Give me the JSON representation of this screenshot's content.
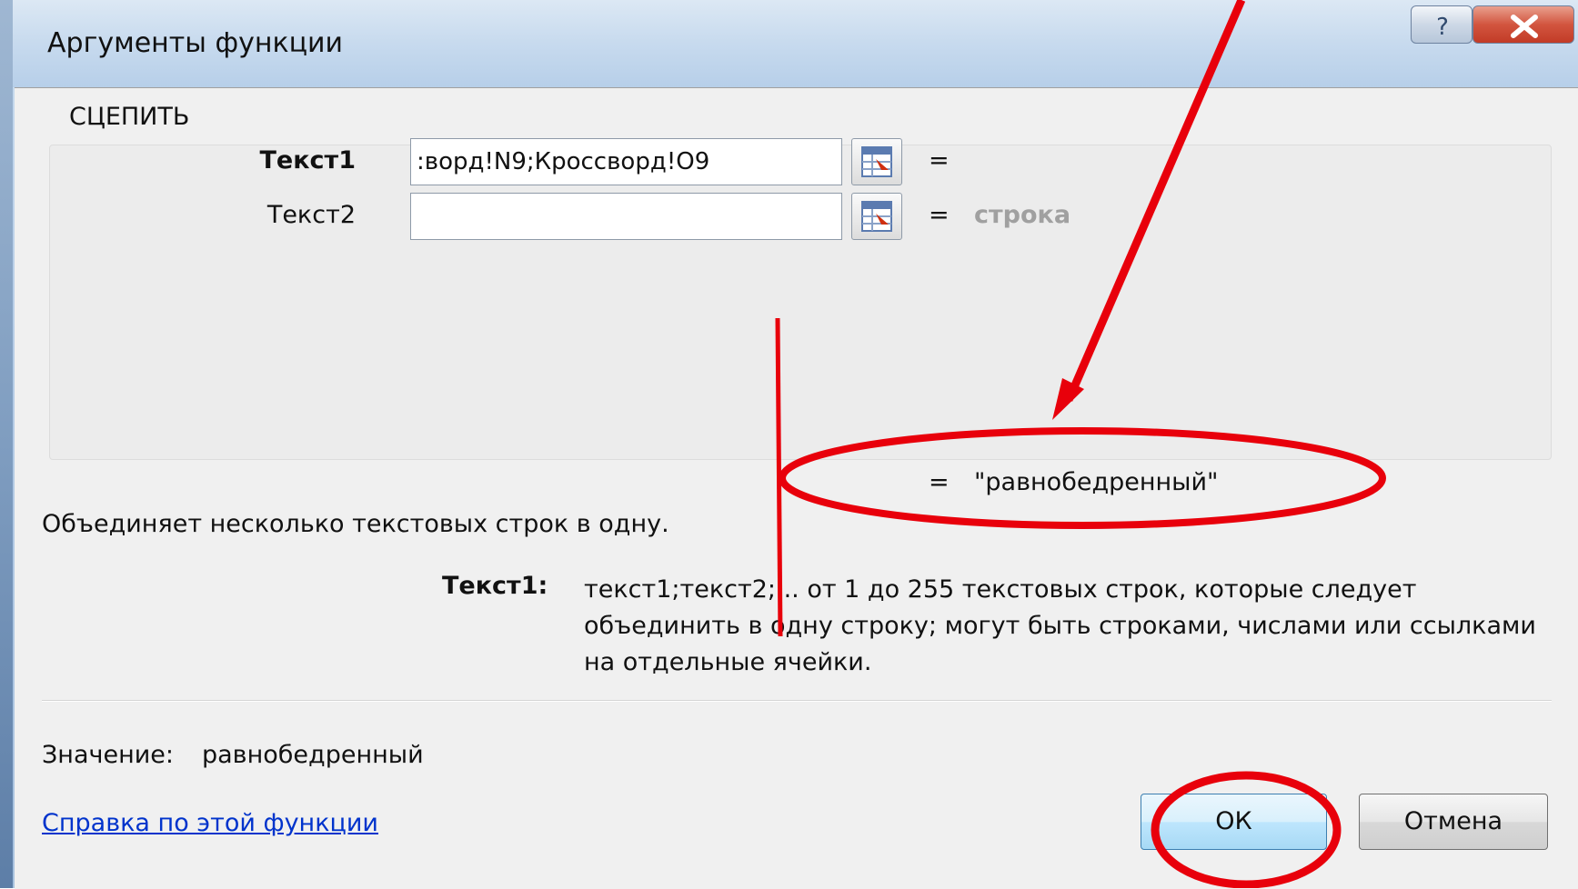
{
  "window": {
    "title": "Аргументы функции",
    "help_glyph": "?",
    "close_glyph": "X"
  },
  "function": {
    "name": "СЦЕПИТЬ",
    "args": [
      {
        "label": "Текст1",
        "value": ":ворд!N9;Кроссворд!O9",
        "eq": "=",
        "result": ""
      },
      {
        "label": "Текст2",
        "value": "",
        "eq": "=",
        "result": "строка"
      }
    ],
    "result_eq": "=",
    "result_value": "\"равнобедренный\""
  },
  "description": {
    "text": "Объединяет несколько текстовых строк в одну.",
    "arg_name": "Текст1:",
    "arg_text": "текст1;текст2;... от 1 до 255 текстовых строк, которые следует объединить в одну строку; могут быть строками, числами или ссылками на отдельные ячейки."
  },
  "value": {
    "label": "Значение:",
    "text": "равнобедренный"
  },
  "footer": {
    "help_link": "Справка по этой функции",
    "ok_label": "ОК",
    "cancel_label": "Отмена"
  },
  "colors": {
    "annotation": "#e8000b",
    "link": "#0033cc",
    "disabled_text": "#a0a0a0"
  },
  "icons": [
    "help-icon",
    "close-icon",
    "collapse-dialog-icon"
  ]
}
